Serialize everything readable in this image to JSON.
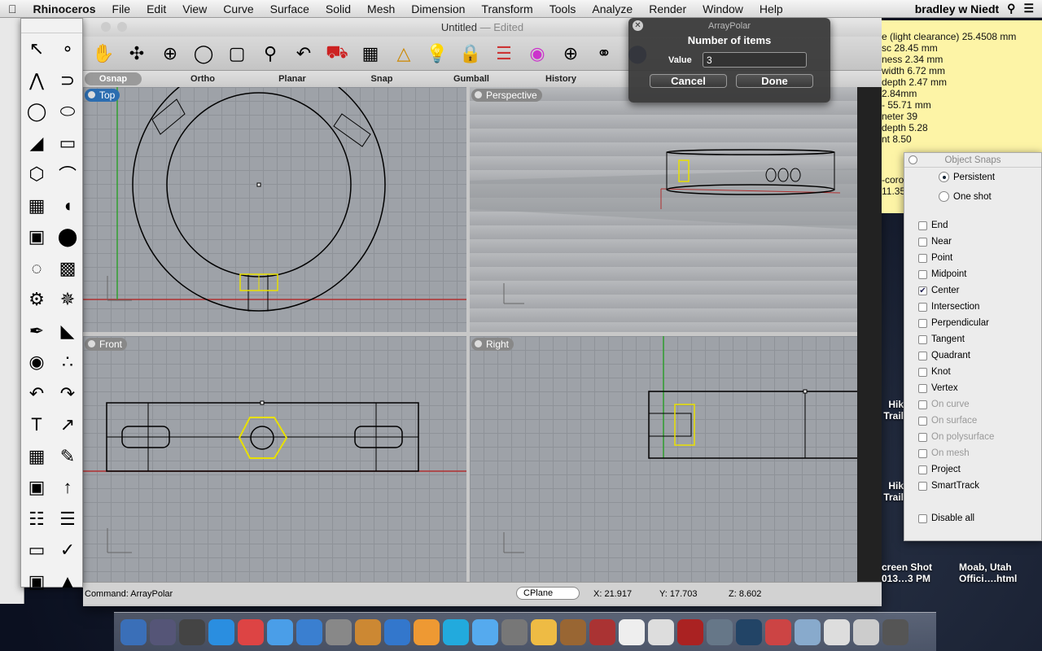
{
  "menubar": {
    "app": "Rhinoceros",
    "items": [
      "File",
      "Edit",
      "View",
      "Curve",
      "Surface",
      "Solid",
      "Mesh",
      "Dimension",
      "Transform",
      "Tools",
      "Analyze",
      "Render",
      "Window",
      "Help"
    ],
    "user": "bradley w Niedt"
  },
  "window": {
    "title": "Untitled",
    "edited": "— Edited"
  },
  "tabs": [
    "Osnap",
    "Ortho",
    "Planar",
    "Snap",
    "Gumball",
    "History"
  ],
  "viewports": {
    "top": "Top",
    "perspective": "Perspective",
    "front": "Front",
    "right": "Right"
  },
  "status": {
    "command": "Command:  ArrayPolar",
    "cplane": "CPlane",
    "x": "X: 21.917",
    "y": "Y: 17.703",
    "z": "Z: 8.602"
  },
  "dialog": {
    "title": "ArrayPolar",
    "heading": "Number of items",
    "value_label": "Value",
    "value": "3",
    "cancel": "Cancel",
    "done": "Done"
  },
  "note": {
    "lines": [
      "e (light clearance) 25.4508 mm",
      "sc 28.45 mm",
      "ness 2.34 mm",
      "width 6.72 mm",
      "depth 2.47 mm",
      "2.84mm",
      "- 55.71 mm",
      "neter 39",
      "depth 5.28",
      "nt 8.50"
    ],
    "lower": [
      "-coro",
      "11.35"
    ]
  },
  "snaps": {
    "title": "Object Snaps",
    "modes": [
      {
        "label": "Persistent",
        "on": true
      },
      {
        "label": "One shot",
        "on": false
      }
    ],
    "items": [
      {
        "label": "End",
        "checked": false
      },
      {
        "label": "Near",
        "checked": false
      },
      {
        "label": "Point",
        "checked": false
      },
      {
        "label": "Midpoint",
        "checked": false
      },
      {
        "label": "Center",
        "checked": true
      },
      {
        "label": "Intersection",
        "checked": false
      },
      {
        "label": "Perpendicular",
        "checked": false
      },
      {
        "label": "Tangent",
        "checked": false
      },
      {
        "label": "Quadrant",
        "checked": false
      },
      {
        "label": "Knot",
        "checked": false
      },
      {
        "label": "Vertex",
        "checked": false
      },
      {
        "label": "On curve",
        "checked": false,
        "disabled": true
      },
      {
        "label": "On surface",
        "checked": false,
        "disabled": true
      },
      {
        "label": "On polysurface",
        "checked": false,
        "disabled": true
      },
      {
        "label": "On mesh",
        "checked": false,
        "disabled": true
      },
      {
        "label": "Project",
        "checked": false
      },
      {
        "label": "SmartTrack",
        "checked": false
      }
    ],
    "disable_all": "Disable all"
  },
  "desktop": [
    {
      "label": "Hik\nTrail"
    },
    {
      "label": "Hik\nTrail"
    },
    {
      "label": "creen Shot\n013…3 PM"
    },
    {
      "label": "Moab, Utah\nOffici….html"
    }
  ],
  "colors": {
    "selection": "#e8e000",
    "x_axis": "#b03030",
    "y_axis": "#30a030",
    "note_bg": "#fdf4a6"
  }
}
